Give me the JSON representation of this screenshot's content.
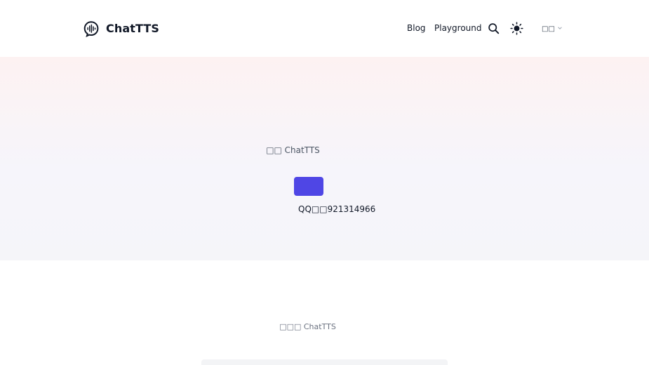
{
  "brand": {
    "name": "ChatTTS",
    "logo_icon": "speech-bubble-waveform-icon"
  },
  "nav": {
    "links": [
      {
        "label": "Blog"
      },
      {
        "label": "Playground"
      }
    ],
    "search_icon": "search-icon",
    "theme_icon": "sun-icon",
    "language": {
      "selected": "□□",
      "icon": "chevron-down-icon"
    }
  },
  "hero": {
    "subtitle": "□□ ChatTTS",
    "button_label": "",
    "contact": "QQ□□921314966"
  },
  "section": {
    "heading": "□□□ ChatTTS"
  },
  "colors": {
    "accent": "#4f46e5",
    "text": "#111827",
    "muted": "#6b7280"
  }
}
